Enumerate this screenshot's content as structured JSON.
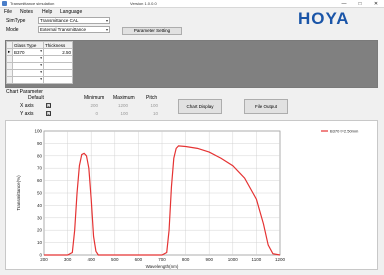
{
  "window": {
    "title": "Transmittance simulation",
    "version": "Version 1.0.0.0",
    "controls": [
      "—",
      "□",
      "✕"
    ]
  },
  "menu": [
    "File",
    "Notes",
    "Help",
    "Language"
  ],
  "sim_type": {
    "label": "SimType",
    "value": "Transmittance CAL"
  },
  "mode": {
    "label": "Mode",
    "value": "External Transmittance"
  },
  "parameter_button": "Parameter Setting",
  "logo": "HOYA",
  "glass_table": {
    "headers": [
      "Glass Type",
      "Thickness"
    ],
    "rows": [
      {
        "glass": "B370",
        "thickness": "2.50"
      },
      {
        "glass": "",
        "thickness": ""
      },
      {
        "glass": "",
        "thickness": ""
      },
      {
        "glass": "",
        "thickness": ""
      },
      {
        "glass": "",
        "thickness": ""
      }
    ]
  },
  "chart_parameter": {
    "title": "Chart Parameter",
    "col_default": "Default",
    "col_min": "Minimum",
    "col_max": "Maximum",
    "col_pitch": "Pitch",
    "x_axis": {
      "label": "X axis",
      "default": "☑",
      "min": "200",
      "max": "1200",
      "pitch": "100"
    },
    "y_axis": {
      "label": "Y axis",
      "default": "☑",
      "min": "0",
      "max": "100",
      "pitch": "10"
    }
  },
  "chart_display_button": "Chart Display",
  "file_output_button": "File Output",
  "colors": {
    "series": "#e53333",
    "accent": "#1a55a8"
  },
  "chart_data": {
    "type": "line",
    "xlabel": "Wavelength(nm)",
    "ylabel": "Transmittance(%)",
    "xlim": [
      200,
      1200
    ],
    "ylim": [
      0,
      100
    ],
    "xticks": [
      "200",
      "300",
      "400",
      "500",
      "600",
      "700",
      "800",
      "900",
      "1000",
      "1100",
      "1200"
    ],
    "yticks": [
      "0",
      "10",
      "20",
      "30",
      "40",
      "50",
      "60",
      "70",
      "80",
      "90",
      "100"
    ],
    "legend_position": "top-right",
    "series": [
      {
        "name": "B370 t=2.50mm",
        "points": [
          [
            200,
            0
          ],
          [
            300,
            0
          ],
          [
            320,
            2
          ],
          [
            330,
            20
          ],
          [
            340,
            50
          ],
          [
            350,
            72
          ],
          [
            360,
            81
          ],
          [
            370,
            82
          ],
          [
            380,
            80
          ],
          [
            390,
            70
          ],
          [
            400,
            45
          ],
          [
            410,
            15
          ],
          [
            420,
            3
          ],
          [
            430,
            0
          ],
          [
            700,
            0
          ],
          [
            720,
            2
          ],
          [
            730,
            20
          ],
          [
            740,
            55
          ],
          [
            750,
            78
          ],
          [
            760,
            86
          ],
          [
            770,
            88
          ],
          [
            800,
            87.5
          ],
          [
            850,
            86
          ],
          [
            900,
            83
          ],
          [
            950,
            78
          ],
          [
            1000,
            72
          ],
          [
            1050,
            62
          ],
          [
            1100,
            45
          ],
          [
            1130,
            25
          ],
          [
            1150,
            8
          ],
          [
            1170,
            1
          ],
          [
            1200,
            0
          ]
        ]
      }
    ]
  }
}
